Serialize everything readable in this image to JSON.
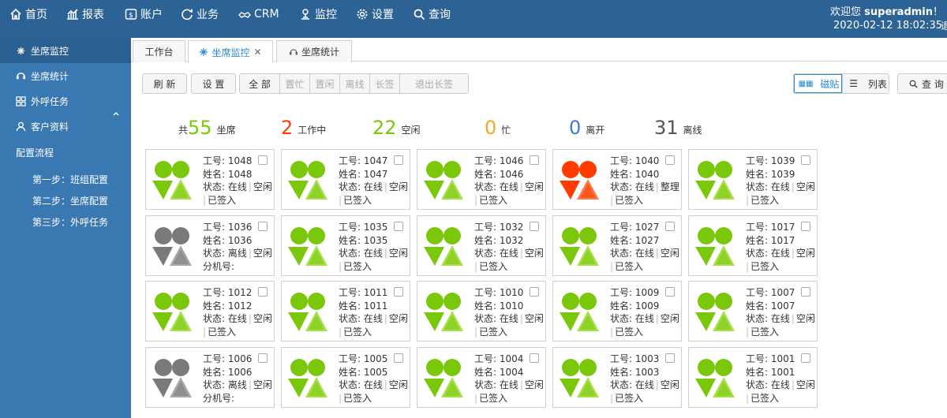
{
  "header": {
    "nav": [
      {
        "label": "首页",
        "icon": "home-icon"
      },
      {
        "label": "报表",
        "icon": "chart-icon"
      },
      {
        "label": "账户",
        "icon": "account-icon"
      },
      {
        "label": "业务",
        "icon": "business-icon"
      },
      {
        "label": "CRM",
        "icon": "crm-icon"
      },
      {
        "label": "监控",
        "icon": "monitor-icon"
      },
      {
        "label": "设置",
        "icon": "gear-icon"
      },
      {
        "label": "查询",
        "icon": "search-icon"
      }
    ],
    "welcome_prefix": "欢迎您 ",
    "username": "superadmin",
    "welcome_suffix": "！",
    "datetime": "2020-02-12 18:02:35",
    "exit_fragment": "退"
  },
  "sidebar": {
    "items": [
      {
        "label": "坐席监控",
        "icon": "headset-icon",
        "active": true
      },
      {
        "label": "坐席统计",
        "icon": "stats-icon",
        "active": false
      },
      {
        "label": "外呼任务",
        "icon": "grid-icon",
        "active": false
      },
      {
        "label": "客户资料",
        "icon": "user-icon",
        "active": false
      },
      {
        "label": "配置流程",
        "icon": "",
        "active": false
      }
    ],
    "subitems": [
      "第一步：班组配置",
      "第二步：坐席配置",
      "第三步：外呼任务"
    ]
  },
  "tabs": [
    {
      "label": "工作台",
      "active": false
    },
    {
      "label": "坐席监控",
      "active": true,
      "closable": true
    },
    {
      "label": "坐席统计",
      "active": false
    }
  ],
  "toolbar": {
    "refresh": "刷 新",
    "settings": "设 置",
    "filters": [
      "全 部",
      "置忙",
      "置闲",
      "离线",
      "长签",
      "退出长签"
    ],
    "view_tile": "磁贴",
    "view_list": "列表",
    "query": "查 询"
  },
  "stats": {
    "total_prefix": "共",
    "total": "55",
    "total_label": "坐席",
    "working": "2",
    "working_label": "工作中",
    "idle": "22",
    "idle_label": "空闲",
    "busy": "0",
    "busy_label": "忙",
    "away": "0",
    "away_label": "离开",
    "offline": "31",
    "offline_label": "离线"
  },
  "colors": {
    "online": "#7ac70c",
    "offline": "#7a7a7a",
    "working": "#ff3b00",
    "busy": "#f5a623",
    "away": "#3a7ad8",
    "offline_count": "#555555"
  },
  "agent_labels": {
    "id": "工号: ",
    "name": "姓名: ",
    "state": "状态: ",
    "ext": "分机号: "
  },
  "agents": [
    {
      "id": "1048",
      "name": "1048",
      "status": "在线",
      "detail": "空闲",
      "signed": "已签入",
      "avatar": "online"
    },
    {
      "id": "1047",
      "name": "1047",
      "status": "在线",
      "detail": "空闲",
      "signed": "已签入",
      "avatar": "online"
    },
    {
      "id": "1046",
      "name": "1046",
      "status": "在线",
      "detail": "空闲",
      "signed": "已签入",
      "avatar": "online"
    },
    {
      "id": "1040",
      "name": "1040",
      "status": "在线",
      "detail": "整理",
      "signed": "已签入",
      "avatar": "working"
    },
    {
      "id": "1039",
      "name": "1039",
      "status": "在线",
      "detail": "空闲",
      "signed": "已签入",
      "avatar": "online"
    },
    {
      "id": "1036",
      "name": "1036",
      "status": "离线",
      "detail": "空闲",
      "signed": "",
      "ext": true,
      "avatar": "offline"
    },
    {
      "id": "1035",
      "name": "1035",
      "status": "在线",
      "detail": "空闲",
      "signed": "已签入",
      "avatar": "online"
    },
    {
      "id": "1032",
      "name": "1032",
      "status": "在线",
      "detail": "空闲",
      "signed": "已签入",
      "avatar": "online"
    },
    {
      "id": "1027",
      "name": "1027",
      "status": "在线",
      "detail": "空闲",
      "signed": "已签入",
      "avatar": "online"
    },
    {
      "id": "1017",
      "name": "1017",
      "status": "在线",
      "detail": "空闲",
      "signed": "已签入",
      "avatar": "online"
    },
    {
      "id": "1012",
      "name": "1012",
      "status": "在线",
      "detail": "空闲",
      "signed": "已签入",
      "avatar": "online"
    },
    {
      "id": "1011",
      "name": "1011",
      "status": "在线",
      "detail": "空闲",
      "signed": "已签入",
      "avatar": "online"
    },
    {
      "id": "1010",
      "name": "1010",
      "status": "在线",
      "detail": "空闲",
      "signed": "已签入",
      "avatar": "online"
    },
    {
      "id": "1009",
      "name": "1009",
      "status": "在线",
      "detail": "空闲",
      "signed": "已签入",
      "avatar": "online"
    },
    {
      "id": "1007",
      "name": "1007",
      "status": "在线",
      "detail": "空闲",
      "signed": "已签入",
      "avatar": "online"
    },
    {
      "id": "1006",
      "name": "1006",
      "status": "离线",
      "detail": "空闲",
      "signed": "",
      "ext": true,
      "avatar": "offline"
    },
    {
      "id": "1005",
      "name": "1005",
      "status": "在线",
      "detail": "空闲",
      "signed": "已签入",
      "avatar": "online"
    },
    {
      "id": "1004",
      "name": "1004",
      "status": "在线",
      "detail": "空闲",
      "signed": "已签入",
      "avatar": "online"
    },
    {
      "id": "1003",
      "name": "1003",
      "status": "在线",
      "detail": "空闲",
      "signed": "已签入",
      "avatar": "online"
    },
    {
      "id": "1001",
      "name": "1001",
      "status": "在线",
      "detail": "空闲",
      "signed": "已签入",
      "avatar": "online"
    }
  ]
}
